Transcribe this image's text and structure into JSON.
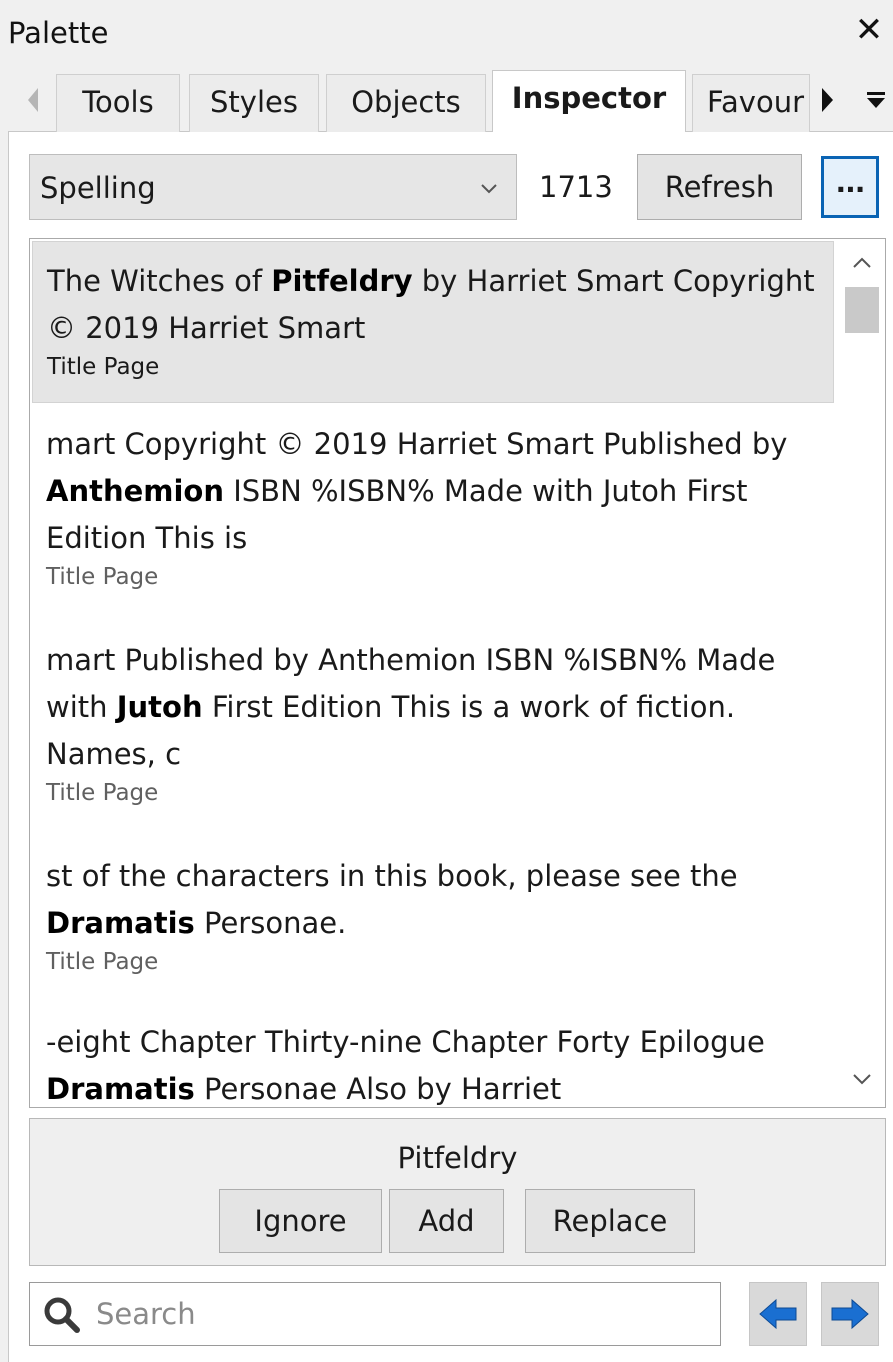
{
  "window": {
    "title": "Palette",
    "close_glyph": "✕"
  },
  "tabs": [
    {
      "label": "Tools",
      "active": false
    },
    {
      "label": "Styles",
      "active": false
    },
    {
      "label": "Objects",
      "active": false
    },
    {
      "label": "Inspector",
      "active": true
    },
    {
      "label": "Favour",
      "active": false
    }
  ],
  "toolbar": {
    "mode_selected": "Spelling",
    "count": "1713",
    "refresh_label": "Refresh",
    "more_label": "···"
  },
  "results": [
    {
      "before": "The Witches of ",
      "match": "Pitfeldry",
      "after": " by Harriet Smart Copyright © 2019 Harriet Smart",
      "location": "Title Page",
      "selected": true
    },
    {
      "before": "mart Copyright © 2019 Harriet Smart Published by ",
      "match": "Anthemion",
      "after": " ISBN %ISBN% Made with Jutoh First Edition This is",
      "location": "Title Page",
      "selected": false
    },
    {
      "before": "mart Published by Anthemion ISBN %ISBN% Made with ",
      "match": "Jutoh",
      "after": " First Edition This is a work of fiction. Names, c",
      "location": "Title Page",
      "selected": false
    },
    {
      "before": "st of the characters in this book, please see the ",
      "match": "Dramatis",
      "after": " Personae.",
      "location": "Title Page",
      "selected": false
    },
    {
      "before": "-eight Chapter Thirty-nine Chapter Forty Epilogue ",
      "match": "Dramatis",
      "after": " Personae Also by Harriet",
      "location": "",
      "selected": false
    }
  ],
  "action": {
    "word": "Pitfeldry",
    "ignore_label": "Ignore",
    "add_label": "Add",
    "replace_label": "Replace"
  },
  "search": {
    "placeholder": "Search",
    "value": ""
  },
  "icons": {
    "search": "magnifier-icon",
    "previous": "arrow-left-icon",
    "next": "arrow-right-icon"
  },
  "colors": {
    "accent_blue": "#1a6fd1",
    "focus_border": "#0a64b4",
    "selected_row": "#e5e5e5"
  }
}
